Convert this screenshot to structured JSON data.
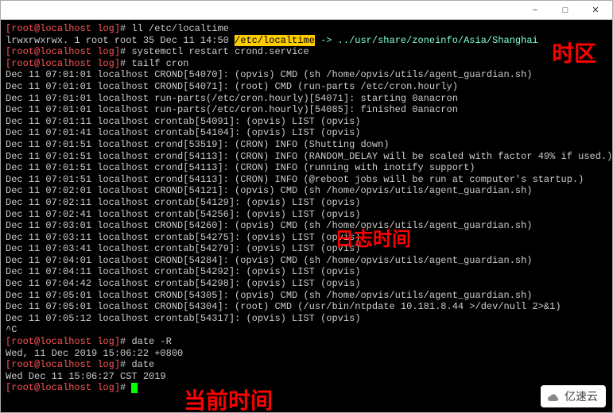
{
  "window": {
    "title": "",
    "buttons": {
      "min": "−",
      "max": "□",
      "close": "✕"
    }
  },
  "prompt": {
    "user": "root",
    "host": "localhost",
    "cwd": "log",
    "symbol": "#"
  },
  "commands": {
    "ll_localtime": "ll /etc/localtime",
    "systemctl": "systemctl restart crond.service",
    "tailf": "tailf cron",
    "date_R": "date -R",
    "date": "date"
  },
  "ll_output": {
    "prefix": "lrwxrwxrwx. 1 root root 35 Dec 11 14:50 ",
    "path": "/etc/localtime",
    "arrow": " -> ../usr/share/zoneinfo/Asia/Shanghai"
  },
  "log_lines": [
    "Dec 11 07:01:01 localhost CROND[54070]: (opvis) CMD (sh /home/opvis/utils/agent_guardian.sh)",
    "Dec 11 07:01:01 localhost CROND[54071]: (root) CMD (run-parts /etc/cron.hourly)",
    "Dec 11 07:01:01 localhost run-parts(/etc/cron.hourly)[54071]: starting 0anacron",
    "Dec 11 07:01:01 localhost run-parts(/etc/cron.hourly)[54085]: finished 0anacron",
    "Dec 11 07:01:11 localhost crontab[54091]: (opvis) LIST (opvis)",
    "Dec 11 07:01:41 localhost crontab[54104]: (opvis) LIST (opvis)",
    "Dec 11 07:01:51 localhost crond[53519]: (CRON) INFO (Shutting down)",
    "Dec 11 07:01:51 localhost crond[54113]: (CRON) INFO (RANDOM_DELAY will be scaled with factor 49% if used.)",
    "Dec 11 07:01:51 localhost crond[54113]: (CRON) INFO (running with inotify support)",
    "Dec 11 07:01:51 localhost crond[54113]: (CRON) INFO (@reboot jobs will be run at computer's startup.)",
    "Dec 11 07:02:01 localhost CROND[54121]: (opvis) CMD (sh /home/opvis/utils/agent_guardian.sh)",
    "Dec 11 07:02:11 localhost crontab[54129]: (opvis) LIST (opvis)",
    "Dec 11 07:02:41 localhost crontab[54256]: (opvis) LIST (opvis)",
    "Dec 11 07:03:01 localhost CROND[54260]: (opvis) CMD (sh /home/opvis/utils/agent_guardian.sh)",
    "Dec 11 07:03:11 localhost crontab[54275]: (opvis) LIST (opvis)",
    "Dec 11 07:03:41 localhost crontab[54279]: (opvis) LIST (opvis)",
    "Dec 11 07:04:01 localhost CROND[54284]: (opvis) CMD (sh /home/opvis/utils/agent_guardian.sh)",
    "Dec 11 07:04:11 localhost crontab[54292]: (opvis) LIST (opvis)",
    "Dec 11 07:04:42 localhost crontab[54298]: (opvis) LIST (opvis)",
    "Dec 11 07:05:01 localhost CROND[54305]: (opvis) CMD (sh /home/opvis/utils/agent_guardian.sh)",
    "Dec 11 07:05:01 localhost CROND[54304]: (root) CMD (/usr/bin/ntpdate 10.181.8.44 >/dev/null 2>&1)",
    "Dec 11 07:05:12 localhost crontab[54317]: (opvis) LIST (opvis)"
  ],
  "interrupt": "^C",
  "date_R_output": "Wed, 11 Dec 2019 15:06:22 +0800",
  "date_output": "Wed Dec 11 15:06:27 CST 2019",
  "annotations": {
    "timezone": "时区",
    "logtime": "日志时间",
    "current_time": "当前时间"
  },
  "watermark": "亿速云"
}
